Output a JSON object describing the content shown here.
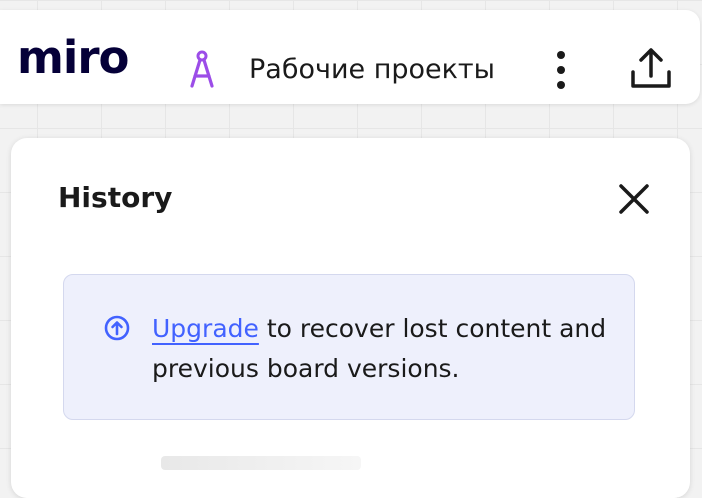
{
  "topbar": {
    "logo_text": "miro",
    "board_icon": "compass-icon",
    "board_name": "Рабочие проекты",
    "more_icon": "more-vertical-icon",
    "share_icon": "upload-icon"
  },
  "history_panel": {
    "title": "History",
    "close_icon": "close-icon",
    "notice": {
      "icon": "upgrade-arrow-circle-icon",
      "link_text": "Upgrade",
      "message": "to recover lost content and previous board versions."
    }
  },
  "colors": {
    "accent": "#4262ff",
    "board_icon": "#9c4de8",
    "notice_background": "#eef0fc",
    "text": "#1a1a1a"
  }
}
